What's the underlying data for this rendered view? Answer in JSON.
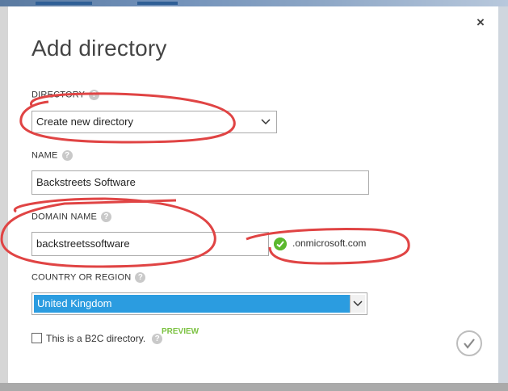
{
  "dialog": {
    "title": "Add directory",
    "close_glyph": "×"
  },
  "directory": {
    "label": "DIRECTORY",
    "value": "Create new directory"
  },
  "name": {
    "label": "NAME",
    "value": "Backstreets Software"
  },
  "domain": {
    "label": "DOMAIN NAME",
    "value": "backstreetssoftware",
    "suffix": ".onmicrosoft.com"
  },
  "country": {
    "label": "COUNTRY OR REGION",
    "value": "United Kingdom"
  },
  "b2c": {
    "label": "This is a B2C directory.",
    "preview": "PREVIEW",
    "checked": false
  },
  "help_glyph": "?",
  "colors": {
    "annotation": "#e04444",
    "accent": "#2b9ce0",
    "success": "#5cb82e",
    "preview": "#7cc242"
  },
  "icons": {
    "close": "close-icon",
    "help": "help-icon",
    "dropdown": "chevron-down-icon",
    "valid": "check-circle-icon",
    "confirm": "checkmark-icon"
  }
}
